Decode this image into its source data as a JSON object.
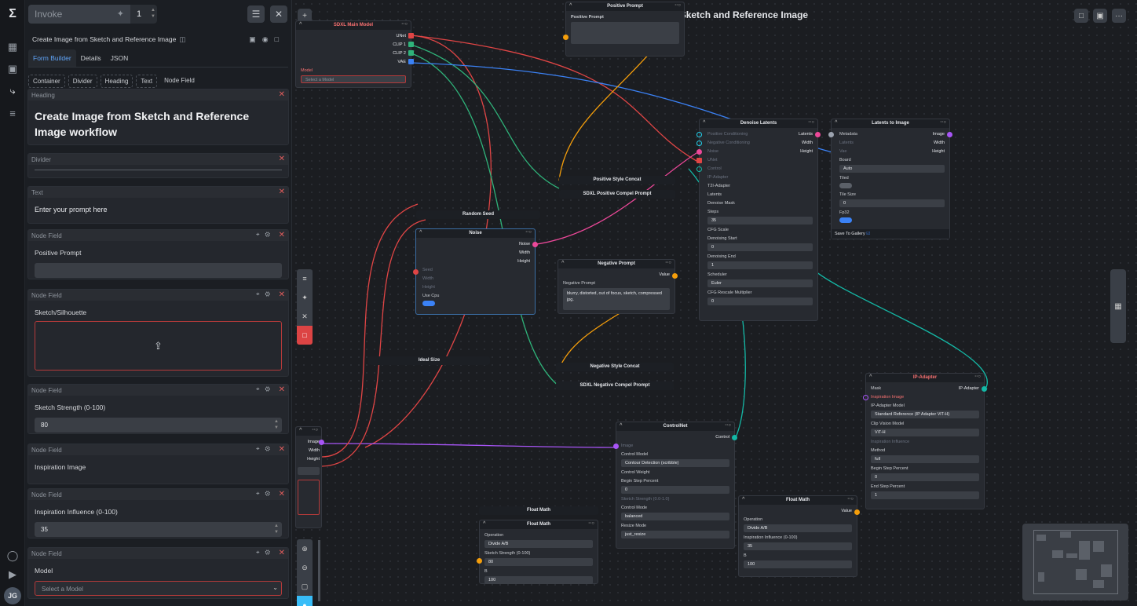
{
  "app": {
    "name": "Invoke",
    "queue_count": "1",
    "logo_glyph": "Σ",
    "avatar_initials": "JG"
  },
  "workflow": {
    "name": "Create Image from Sketch and Reference Image",
    "canvas_title": "Create Image from Sketch and Reference Image"
  },
  "tabs": [
    "Form Builder",
    "Details",
    "JSON"
  ],
  "palette": [
    "Container",
    "Divider",
    "Heading",
    "Text",
    "Node Field"
  ],
  "form": {
    "heading": {
      "header": "Heading",
      "text": "Create Image from Sketch and Reference Image workflow"
    },
    "divider": {
      "header": "Divider"
    },
    "text": {
      "header": "Text",
      "text": "Enter your prompt here"
    },
    "field_header": "Node Field",
    "positive_prompt": {
      "label": "Positive Prompt",
      "value": ""
    },
    "sketch": {
      "label": "Sketch/Silhouette"
    },
    "sketch_strength": {
      "label": "Sketch Strength (0-100)",
      "value": "80"
    },
    "inspiration_image": {
      "label": "Inspiration Image"
    },
    "inspiration_influence": {
      "label": "Inspiration Influence (0-100)",
      "value": "35"
    },
    "model": {
      "label": "Model",
      "placeholder": "Select a Model"
    }
  },
  "nodes": {
    "sdxl_main": {
      "title": "SDXL Main Model",
      "outputs": [
        "UNet",
        "CLIP 1",
        "CLIP 2",
        "VAE"
      ],
      "model_label": "Model",
      "model_placeholder": "Select a Model"
    },
    "positive_prompt": {
      "title": "Positive Prompt",
      "field": "Positive Prompt"
    },
    "denoise": {
      "title": "Denoise Latents",
      "inputs": [
        "Positive Conditioning",
        "Negative Conditioning",
        "Noise",
        "UNet",
        "Control",
        "IP-Adapter",
        "T2I-Adapter",
        "Latents",
        "Denoise Mask"
      ],
      "outputs": [
        "Latents",
        "Width",
        "Height"
      ],
      "steps_label": "Steps",
      "steps": "35",
      "cfg_label": "CFG Scale",
      "start_label": "Denoising Start",
      "start": "0",
      "end_label": "Denoising End",
      "end": "1",
      "sched_label": "Scheduler",
      "sched": "Euler",
      "rescale_label": "CFG Rescale Multiplier",
      "rescale": "0"
    },
    "l2i": {
      "title": "Latents to Image",
      "inputs": [
        "Metadata",
        "Latents",
        "Vae"
      ],
      "outputs": [
        "Image",
        "Width",
        "Height"
      ],
      "board_label": "Board",
      "board": "Auto",
      "tiled_label": "Tiled",
      "tile_label": "Tile Size",
      "tile": "0",
      "fp32_label": "Fp32",
      "gallery_label": "Save To Gallery"
    },
    "pos_style": {
      "title": "Positive Style Concat"
    },
    "pos_compel": {
      "title": "SDXL Positive Compel Prompt"
    },
    "random_seed": {
      "title": "Random Seed"
    },
    "noise": {
      "title": "Noise",
      "outputs": [
        "Noise",
        "Width",
        "Height"
      ],
      "inputs": [
        "Seed",
        "Width",
        "Height"
      ],
      "cpu_label": "Use Cpu"
    },
    "neg_prompt": {
      "title": "Negative Prompt",
      "out": "Value",
      "field": "Negative Prompt",
      "text": "blurry, distorted, out of focus, sketch, compressed jpg."
    },
    "ideal": {
      "title": "Ideal Size"
    },
    "neg_style": {
      "title": "Negative Style Concat"
    },
    "neg_compel": {
      "title": "SDXL Negative Compel Prompt"
    },
    "controlnet": {
      "title": "ControlNet",
      "out": "Control",
      "image": "Image",
      "model_label": "Control Model",
      "model": "Contour Detection (scribble)",
      "weight_label": "Control Weight",
      "bsp_label": "Begin Step Percent",
      "bsp": "0",
      "strength": "Sketch Strength (0.0-1.0)",
      "mode_label": "Control Mode",
      "mode": "balanced",
      "resize_label": "Resize Mode",
      "resize": "just_resize"
    },
    "ipa": {
      "title": "IP-Adapter",
      "mask": "Mask",
      "out": "IP-Adapter",
      "image": "Inspiration Image",
      "model_label": "IP-Adapter Model",
      "model": "Standard Reference (IP Adapter ViT-H)",
      "clip_label": "Clip Vision Model",
      "clip": "ViT-H",
      "influence": "Inspiration Influence",
      "method_label": "Method",
      "method": "full",
      "bsp_label": "Begin Step Percent",
      "bsp": "0",
      "esp_label": "End Step Percent",
      "esp": "1"
    },
    "fm_a": {
      "title": "Float Math"
    },
    "fm_b": {
      "title": "Float Math",
      "op_label": "Operation",
      "op": "Divide A/B",
      "a_label": "Sketch Strength (0-100)",
      "a": "80",
      "b_label": "B",
      "b": "100"
    },
    "fm_c": {
      "title": "Float Math",
      "out": "Value",
      "op_label": "Operation",
      "op": "Divide A/B",
      "a_label": "Inspiration Influence (0-100)",
      "a": "35",
      "b_label": "B",
      "b": "100"
    },
    "image": {
      "outputs": [
        "Image",
        "Width",
        "Height"
      ]
    }
  },
  "colors": {
    "accent": "#60a5fa",
    "error": "#e05c5c",
    "unet": "#e04545",
    "clip": "#2fb37a",
    "vae": "#3b82f6",
    "latents": "#ec4899",
    "image": "#a855f7",
    "float": "#f59e0b",
    "control": "#14b8a6"
  }
}
